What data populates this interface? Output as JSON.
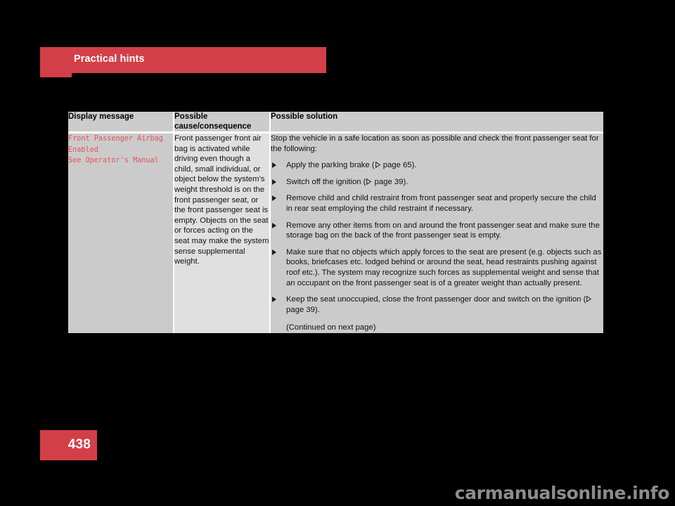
{
  "header": {
    "title": "Practical hints",
    "accent_color": "#d33f48"
  },
  "table": {
    "columns": [
      {
        "header": "Display message"
      },
      {
        "header": "Possible\ncause/consequence"
      },
      {
        "header": "Possible solution"
      }
    ],
    "row": {
      "display_message": "Front Passenger Airbag\nEnabled\nSee Operator's Manual",
      "display_message_color": "#e8535b",
      "possible_cause": "Front passenger front air bag is activated while driving even though a child, small individual, or object below the system’s weight threshold is on the front passenger seat, or the front passenger seat is empty. Objects on the seat or forces acting on the seat may make the system sense supplemental weight.",
      "solution": {
        "intro": "Stop the vehicle in a safe location as soon as possible and check the front passenger seat for the following:",
        "bullets": [
          {
            "before": "Apply the parking brake (",
            "pageref": " page 65",
            "after": ")."
          },
          {
            "before": "Switch off the ignition (",
            "pageref": " page 39",
            "after": ")."
          },
          {
            "before": "Remove child and child restraint from front passenger seat and properly secure the child in rear seat employing the child restraint if necessary.",
            "pageref": "",
            "after": ""
          },
          {
            "before": "Remove any other items from on and around the front passenger seat and make sure the storage bag on the back of the front passenger seat is empty.",
            "pageref": "",
            "after": ""
          },
          {
            "before": "Make sure that no objects which apply forces to the seat are present (e.g. objects such as books, briefcases etc. lodged behind or around the seat, head restraints pushing against roof etc.). The system may recognize such forces as supplemental weight and sense that an occupant on the front passenger seat is of a greater weight than actually present.",
            "pageref": "",
            "after": ""
          },
          {
            "before": "Keep the seat unoccupied, close the front passenger door and switch on the ignition (",
            "pageref": " page 39",
            "after": ")."
          }
        ],
        "continued": "(Continued on next page)"
      }
    }
  },
  "footer": {
    "page_number": "438",
    "watermark": "carmanualsonline.info"
  }
}
